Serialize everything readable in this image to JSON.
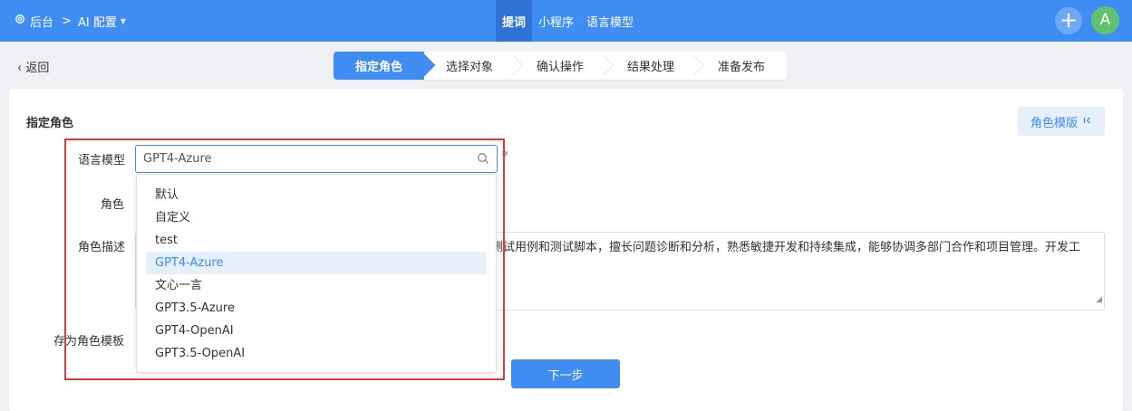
{
  "topbar": {
    "home_label": "后台",
    "separator": ">",
    "ai_label": "AI 配置",
    "nav": [
      {
        "label": "提词",
        "active": true
      },
      {
        "label": "小程序",
        "active": false
      },
      {
        "label": "语言模型",
        "active": false
      }
    ],
    "plus_label": "+",
    "avatar_letter": "A"
  },
  "back_label": "返回",
  "steps": [
    "指定角色",
    "选择对象",
    "确认操作",
    "结果处理",
    "准备发布"
  ],
  "form": {
    "section_title": "指定角色",
    "template_button": "角色模版",
    "model_label": "语言模型",
    "model_value": "GPT4-Azure",
    "role_label": "角色",
    "desc_label": "角色描述",
    "desc_value": "测试用例和测试脚本，擅长问题诊断和分析，熟悉敏捷开发和持续集成，能够协调多部门合作和项目管理。开发工",
    "save_label": "存为角色模板",
    "next_button": "下一步"
  },
  "dropdown": {
    "options": [
      "默认",
      "自定义",
      "test",
      "GPT4-Azure",
      "文心一言",
      "GPT3.5-Azure",
      "GPT4-OpenAI",
      "GPT3.5-OpenAI"
    ],
    "selected_index": 3
  },
  "colors": {
    "primary": "#3f8cf2",
    "highlight": "#e53935"
  }
}
